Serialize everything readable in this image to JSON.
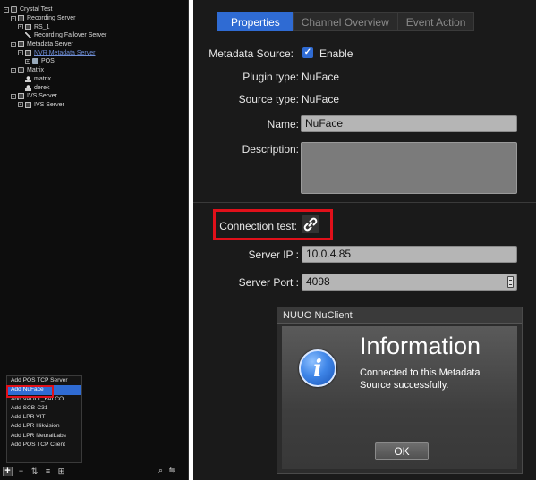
{
  "tree": {
    "root": "Crystal Test",
    "recording_server": "Recording Server",
    "rs1": "RS_1",
    "failover": "Recording Failover Server",
    "metadata_server": "Metadata Server",
    "nvr_metadata": "NVR Metadata Server",
    "pos": "POS",
    "matrix": "Matrix",
    "matrix_child": "matrix",
    "derek": "derek",
    "ivs_server": "IVS Server",
    "ivs_child": "IVS Server"
  },
  "menu": {
    "items": [
      "Add POS TCP Server",
      "Add NuFace",
      "Add VAULT_FALCO",
      "Add SCB-C31",
      "Add LPR VIT",
      "Add LPR Hikvision",
      "Add LPR NeuralLabs",
      "Add POS TCP Client"
    ],
    "selected_index": 1
  },
  "tabs": [
    "Properties",
    "Channel Overview",
    "Event Action"
  ],
  "form": {
    "metadata_source_label": "Metadata Source:",
    "enable_label": "Enable",
    "enable_checked": true,
    "plugin_type_label": "Plugin type:",
    "plugin_type_value": "NuFace",
    "source_type_label": "Source type:",
    "source_type_value": "NuFace",
    "name_label": "Name:",
    "name_value": "NuFace",
    "description_label": "Description:",
    "description_value": "",
    "connection_test_label": "Connection test:",
    "server_ip_label": "Server IP :",
    "server_ip_value": "10.0.4.85",
    "server_port_label": "Server Port :",
    "server_port_value": "4098"
  },
  "dialog": {
    "title": "NUUO NuClient",
    "heading": "Information",
    "message": "Connected to this Metadata Source successfully.",
    "ok_label": "OK"
  },
  "colors": {
    "accent": "#2f6bd3",
    "highlight_box": "#e0101a"
  }
}
